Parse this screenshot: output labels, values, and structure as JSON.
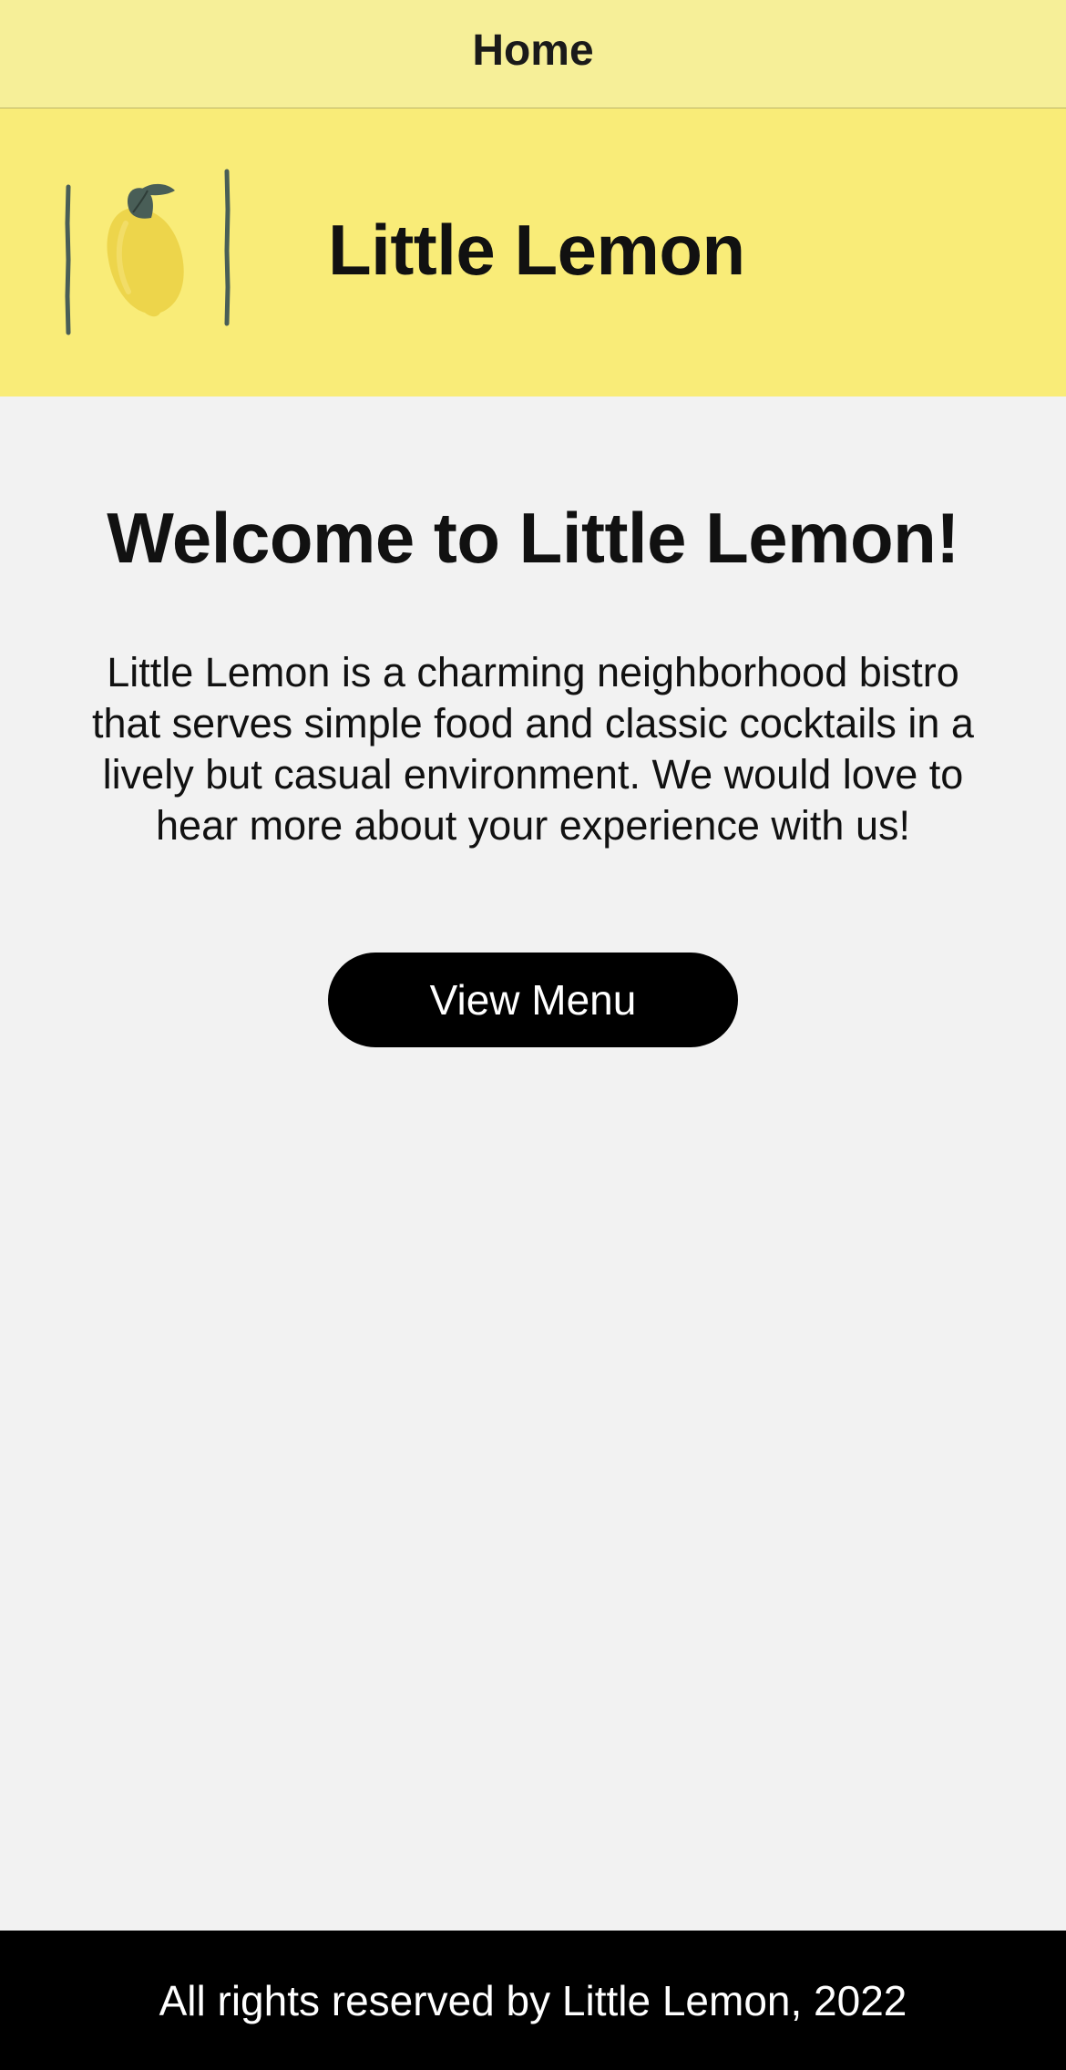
{
  "nav": {
    "title": "Home"
  },
  "header": {
    "brand_title": "Little Lemon",
    "logo_icon": "lemon-logo-icon"
  },
  "main": {
    "welcome_title": "Welcome to Little Lemon!",
    "intro_text": "Little Lemon is a charming neighborhood bistro that serves simple food and classic cocktails in a lively but casual environment. We would love to hear more about your experience with us!",
    "menu_button_label": "View Menu"
  },
  "footer": {
    "text": "All rights reserved by Little Lemon, 2022"
  },
  "colors": {
    "nav_background": "#F6EF98",
    "header_background": "#F9EC78",
    "page_background": "#F2F2F2",
    "button_background": "#000000",
    "footer_background": "#000000",
    "lemon": "#EDD54B",
    "leaf": "#495E57"
  }
}
